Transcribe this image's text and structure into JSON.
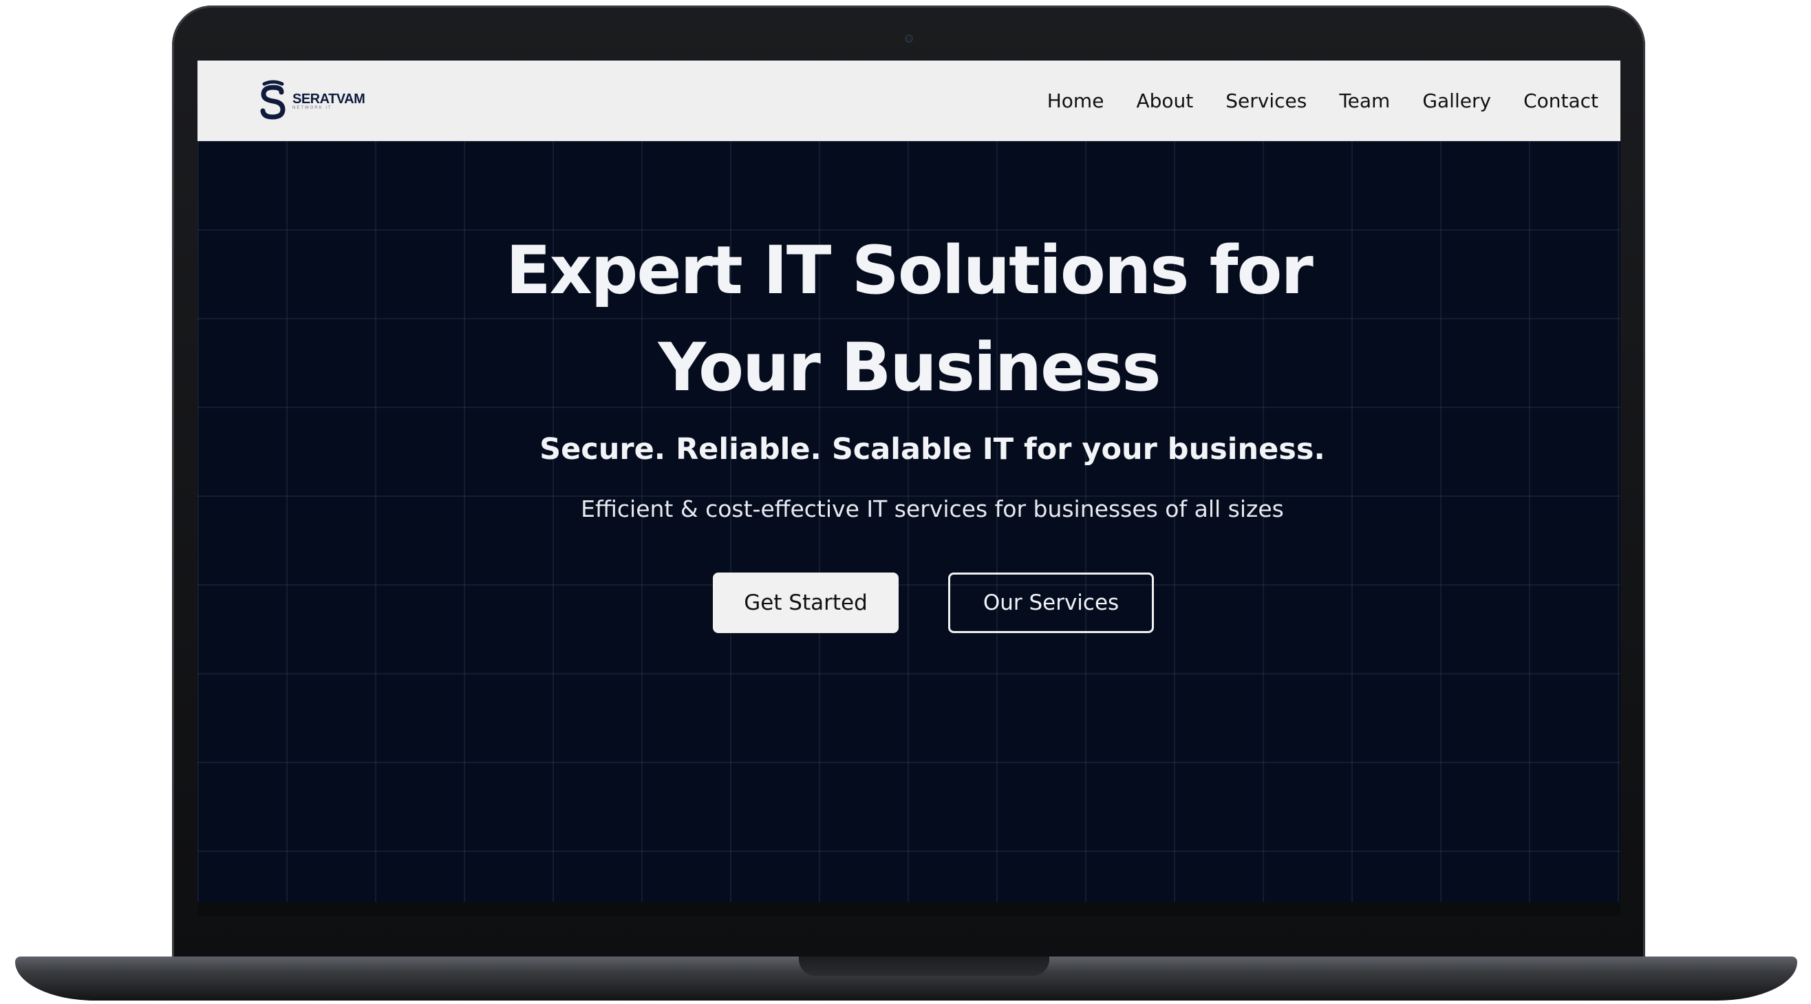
{
  "brand": {
    "name": "SERATVAM",
    "tagline": "NETWORK IT",
    "color": "#0f1b3d"
  },
  "nav": {
    "items": [
      {
        "label": "Home"
      },
      {
        "label": "About"
      },
      {
        "label": "Services"
      },
      {
        "label": "Team"
      },
      {
        "label": "Gallery"
      },
      {
        "label": "Contact"
      }
    ]
  },
  "hero": {
    "title_line1": "Expert IT Solutions for",
    "title_line2": "Your Business",
    "subtitle": "Secure. Reliable. Scalable IT for your business.",
    "description": "Efficient & cost-effective IT services for businesses of all sizes",
    "primary_button": "Get Started",
    "secondary_button": "Our Services",
    "background_color": "#050c1e"
  }
}
